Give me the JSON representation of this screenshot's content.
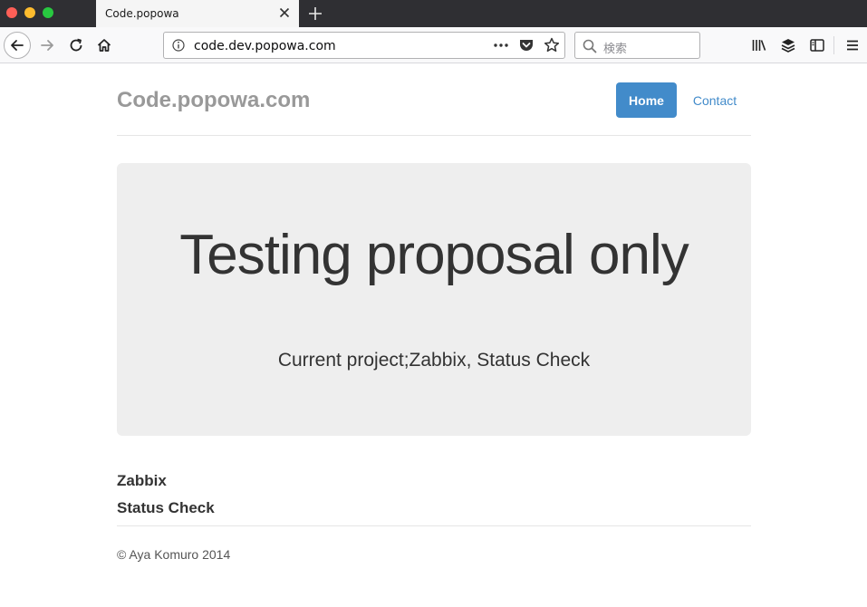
{
  "browser": {
    "tab_title": "Code.popowa",
    "url": "code.dev.popowa.com",
    "search_placeholder": "検索"
  },
  "site": {
    "brand": "Code.popowa.com",
    "nav": [
      {
        "label": "Home",
        "active": true
      },
      {
        "label": "Contact",
        "active": false
      }
    ]
  },
  "jumbotron": {
    "title": "Testing proposal only",
    "lead": "Current project;Zabbix, Status Check"
  },
  "items": [
    "Zabbix",
    "Status Check"
  ],
  "footer": "© Aya Komuro 2014",
  "colors": {
    "primary": "#428bca",
    "jumbotron_bg": "#eeeeee",
    "brand_text": "#999999",
    "body_text": "#333333"
  }
}
